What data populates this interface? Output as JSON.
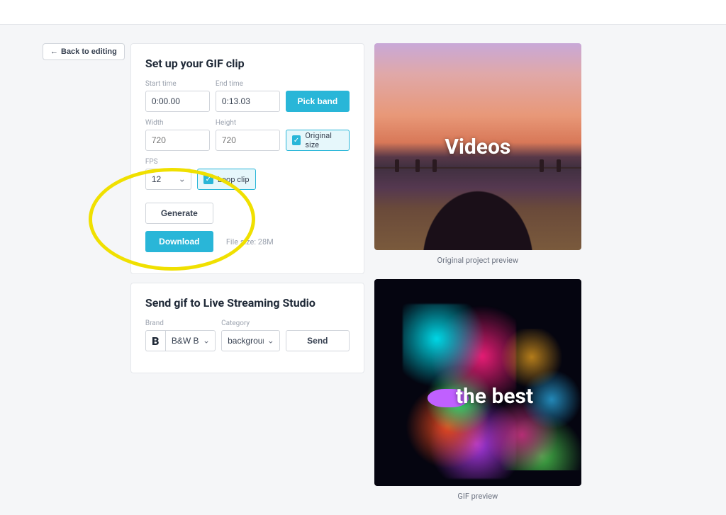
{
  "back_button": "Back to editing",
  "gif_card": {
    "title": "Set up your GIF clip",
    "start_time": {
      "label": "Start time",
      "value": "0:00.00"
    },
    "end_time": {
      "label": "End time",
      "value": "0:13.03"
    },
    "pick_band": "Pick band",
    "width": {
      "label": "Width",
      "placeholder": "720"
    },
    "height": {
      "label": "Height",
      "placeholder": "720"
    },
    "original_size": "Original size",
    "fps": {
      "label": "FPS",
      "value": "12"
    },
    "loop_clip": "Loop clip",
    "generate": "Generate",
    "download": "Download",
    "file_size": "File size: 28M"
  },
  "send_card": {
    "title": "Send gif to Live Streaming Studio",
    "brand": {
      "label": "Brand",
      "value": "B&W Brand"
    },
    "category": {
      "label": "Category",
      "value": "background"
    },
    "send": "Send"
  },
  "previews": {
    "original": {
      "overlay_text": "Videos",
      "caption": "Original project preview"
    },
    "gif": {
      "overlay_text": "the best",
      "caption": "GIF preview"
    }
  }
}
